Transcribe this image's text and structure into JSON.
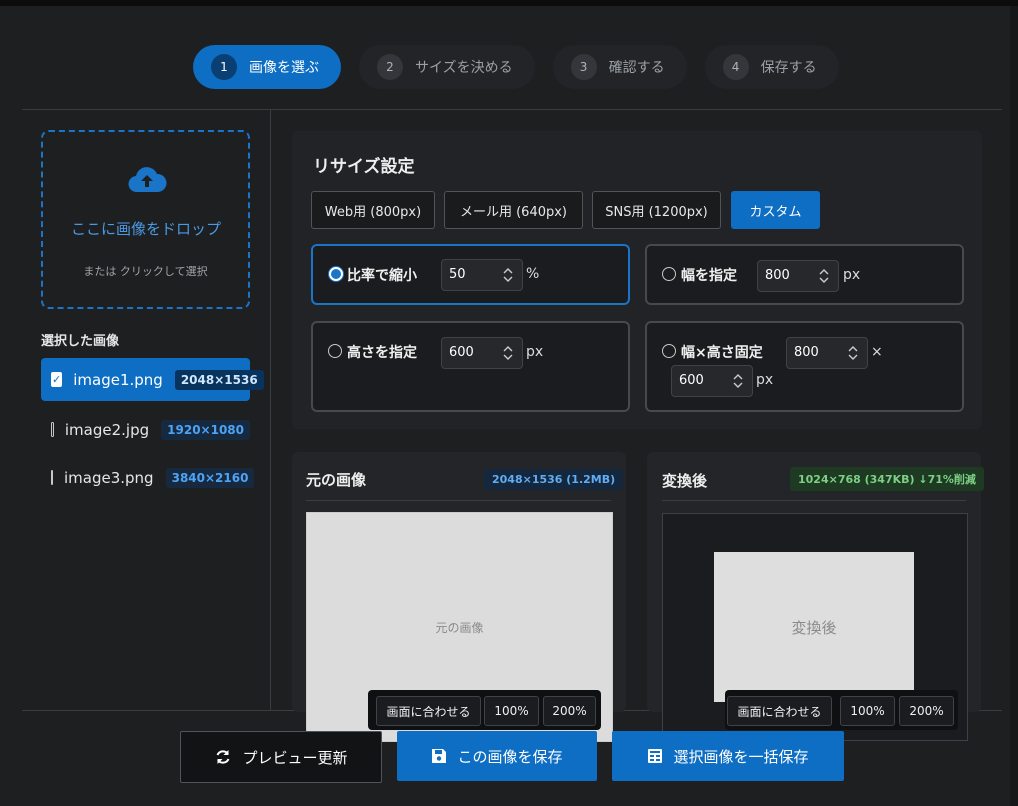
{
  "steps": [
    {
      "num": "1",
      "label": "画像を選ぶ"
    },
    {
      "num": "2",
      "label": "サイズを決める"
    },
    {
      "num": "3",
      "label": "確認する"
    },
    {
      "num": "4",
      "label": "保存する"
    }
  ],
  "dropzone": {
    "title": "ここに画像をドロップ",
    "subtitle": "または クリックして選択"
  },
  "selected": {
    "title": "選択した画像",
    "files": [
      {
        "name": "image1.png",
        "dims": "2048×1536",
        "checked": true
      },
      {
        "name": "image2.jpg",
        "dims": "1920×1080",
        "checked": false
      },
      {
        "name": "image3.png",
        "dims": "3840×2160",
        "checked": false
      }
    ]
  },
  "resize": {
    "title": "リサイズ設定",
    "presets": [
      "Web用 (800px)",
      "メール用 (640px)",
      "SNS用 (1200px)",
      "カスタム"
    ],
    "active_preset": "カスタム",
    "options": {
      "ratio": {
        "label": "比率で縮小",
        "value": "50",
        "unit": "%",
        "selected": true
      },
      "width": {
        "label": "幅を指定",
        "value": "800",
        "unit": "px"
      },
      "height": {
        "label": "高さを指定",
        "value": "600",
        "unit": "px"
      },
      "fixed": {
        "label": "幅×高さ固定",
        "w": "800",
        "times": "×",
        "h": "600",
        "unit": "px"
      }
    }
  },
  "original": {
    "title": "元の画像",
    "badge": "2048×1536 (1.2MB)",
    "placeholder": "元の画像"
  },
  "converted": {
    "title": "変換後",
    "badge": "1024×768 (347KB) ↓71%削減",
    "placeholder": "変換後"
  },
  "zoom": {
    "fit": "画面に合わせる",
    "z100": "100%",
    "z200": "200%"
  },
  "actions": {
    "refresh": "プレビュー更新",
    "save": "この画像を保存",
    "save_all": "選択画像を一括保存"
  },
  "colors": {
    "accent": "#0d6ec4",
    "background": "#1e1f21",
    "success": "#7ecf86"
  }
}
